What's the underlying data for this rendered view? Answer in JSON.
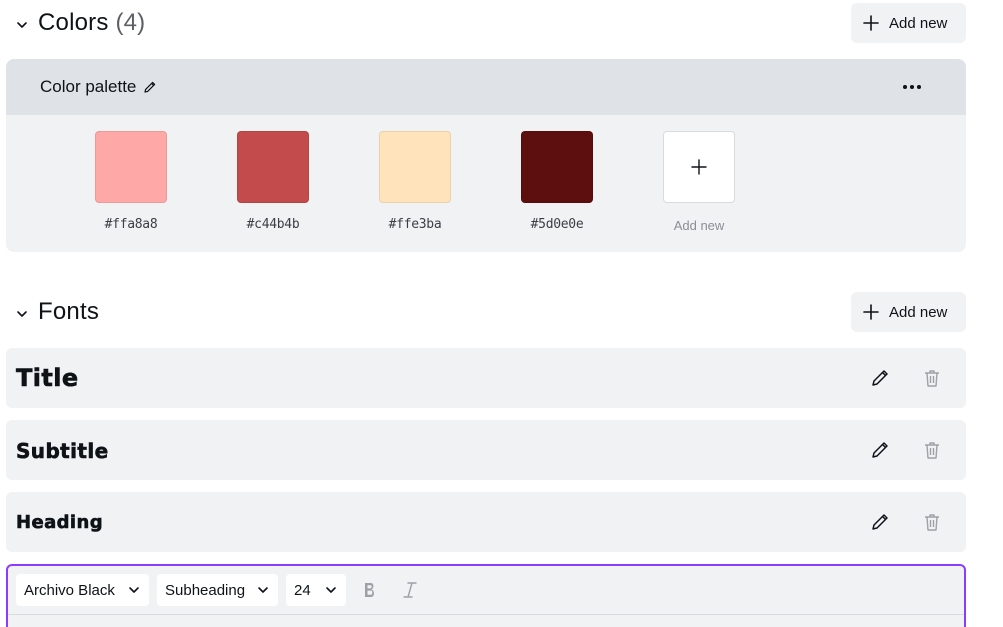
{
  "colors_section": {
    "title": "Colors",
    "count": "(4)",
    "add_label": "Add new"
  },
  "palette": {
    "name": "Color palette",
    "swatches": [
      {
        "hex": "#ffa8a8",
        "label": "#ffa8a8"
      },
      {
        "hex": "#c44b4b",
        "label": "#c44b4b"
      },
      {
        "hex": "#ffe3ba",
        "label": "#ffe3ba"
      },
      {
        "hex": "#5d0e0e",
        "label": "#5d0e0e"
      }
    ],
    "add_label": "Add new"
  },
  "fonts_section": {
    "title": "Fonts",
    "add_label": "Add new",
    "items": [
      {
        "label": "Title"
      },
      {
        "label": "Subtitle"
      },
      {
        "label": "Heading"
      }
    ]
  },
  "editor": {
    "font_family": "Archivo Black",
    "style": "Subheading",
    "size": "24"
  },
  "icons": {
    "chevron": "chevron-down-icon",
    "plus": "plus-icon",
    "pencil": "pencil-icon",
    "more": "more-horizontal-icon",
    "trash": "trash-icon",
    "bold": "bold-icon",
    "italic": "italic-icon"
  },
  "colors": {
    "accent": "#8b3dff",
    "panel": "#f1f2f4",
    "panel_header": "#dfe2e6"
  }
}
